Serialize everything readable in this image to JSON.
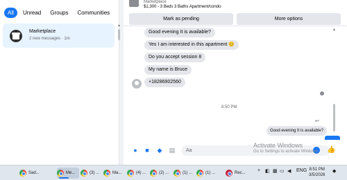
{
  "sidebar": {
    "filters": [
      "All",
      "Unread",
      "Groups",
      "Communities"
    ],
    "conversation": {
      "name": "Marketplace",
      "subtitle": "2 new messages · 1m"
    }
  },
  "header": {
    "source": "Marketplace",
    "listing": "$1,300 - 3 Beds 3 Baths Apartment/condo",
    "mark_pending": "Mark as pending",
    "more_options": "More options"
  },
  "messages": {
    "incoming": [
      "Good evening It is available?",
      "Yes I am interested in this apartment 😊",
      "Do you accept session 8",
      "My name is Bruce",
      "+18286902560"
    ],
    "time": "8:50 PM",
    "outgoing": "Good evening It is available?"
  },
  "composer": {
    "placeholder": "Aa"
  },
  "watermark": {
    "title": "Activate Windows",
    "subtitle": "Go to Settings to activate Windows."
  },
  "taskbar": {
    "apps": [
      "Sad...",
      "Me...",
      "(3) ...",
      "Ma...",
      "(4) ...",
      "(2) ...",
      "(1) ...",
      "(1) ...",
      "Rec..."
    ],
    "language": "ENG",
    "time": "8:51 PM",
    "date": "3/5/2026"
  }
}
